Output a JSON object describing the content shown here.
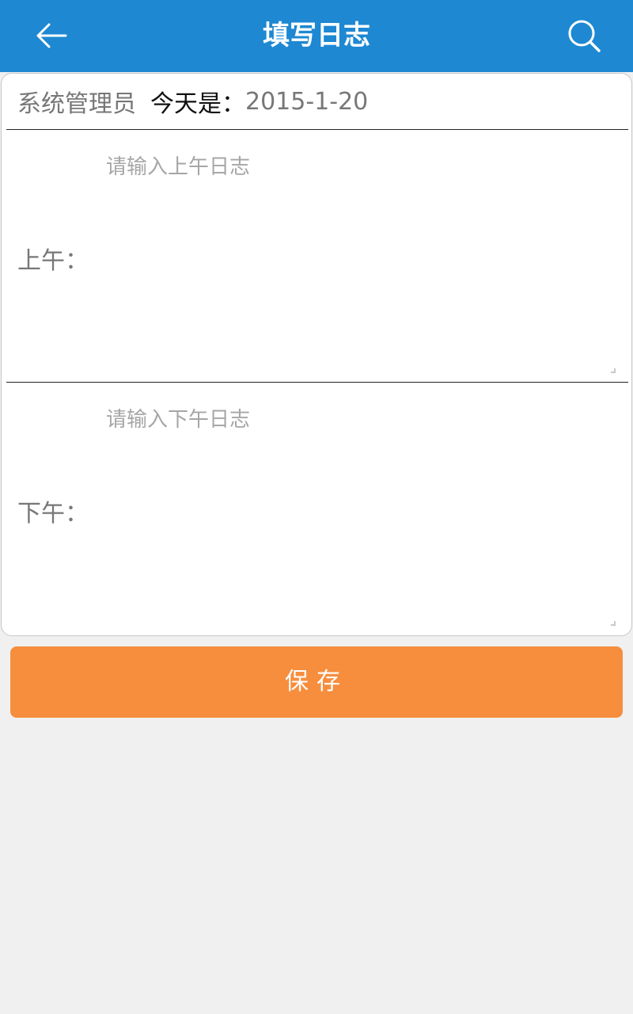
{
  "header": {
    "title": "填写日志",
    "back_icon": "arrow-left-icon",
    "search_icon": "search-icon",
    "background": "#1e88d2"
  },
  "info": {
    "user_name": "系统管理员",
    "today_label": "今天是：",
    "date": "2015-1-20"
  },
  "morning": {
    "label": "上午：",
    "placeholder": "请输入上午日志",
    "value": ""
  },
  "afternoon": {
    "label": "下午：",
    "placeholder": "请输入下午日志",
    "value": ""
  },
  "save": {
    "label": "保存",
    "color": "#f68e3e"
  }
}
